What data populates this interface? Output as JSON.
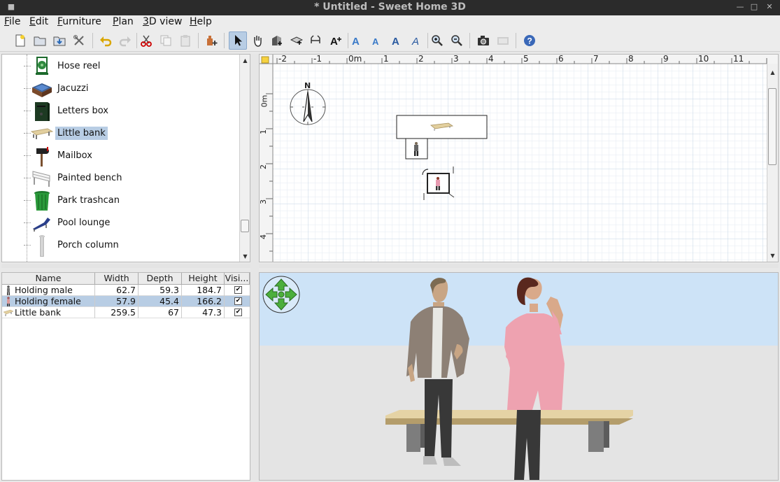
{
  "window": {
    "title": "* Untitled - Sweet Home 3D"
  },
  "menu": [
    {
      "label": "File",
      "u": "F",
      "rest": "ile"
    },
    {
      "label": "Edit",
      "u": "E",
      "rest": "dit"
    },
    {
      "label": "Furniture",
      "u": "F",
      "rest": "urniture"
    },
    {
      "label": "Plan",
      "u": "P",
      "rest": "lan"
    },
    {
      "label": "3D view",
      "u": "3",
      "rest": "D view"
    },
    {
      "label": "Help",
      "u": "H",
      "rest": "elp"
    }
  ],
  "catalog": {
    "items": [
      {
        "label": "Hose reel",
        "icon": "hose-reel-icon"
      },
      {
        "label": "Jacuzzi",
        "icon": "jacuzzi-icon"
      },
      {
        "label": "Letters box",
        "icon": "letters-box-icon"
      },
      {
        "label": "Little bank",
        "icon": "bench-icon",
        "selected": true
      },
      {
        "label": "Mailbox",
        "icon": "mailbox-icon"
      },
      {
        "label": "Painted bench",
        "icon": "painted-bench-icon"
      },
      {
        "label": "Park trashcan",
        "icon": "trashcan-icon"
      },
      {
        "label": "Pool lounge",
        "icon": "pool-lounge-icon"
      },
      {
        "label": "Porch column",
        "icon": "column-icon"
      }
    ]
  },
  "furniture_table": {
    "columns": [
      "Name",
      "Width",
      "Depth",
      "Height",
      "Visi..."
    ],
    "rows": [
      {
        "name": "Holding male",
        "width": "62.7",
        "depth": "59.3",
        "height": "184.7",
        "visible": "✔"
      },
      {
        "name": "Holding female",
        "width": "57.9",
        "depth": "45.4",
        "height": "166.2",
        "visible": "✔",
        "selected": true
      },
      {
        "name": "Little bank",
        "width": "259.5",
        "depth": "67",
        "height": "47.3",
        "visible": "✔"
      }
    ]
  },
  "plan": {
    "ruler_x": [
      "-2",
      "-1",
      "0m",
      "1",
      "2",
      "3",
      "4",
      "5",
      "6",
      "7",
      "8",
      "9",
      "10",
      "11"
    ],
    "ruler_y": [
      "0m",
      "1",
      "2",
      "3",
      "4"
    ],
    "compass_label": "N"
  },
  "colors": {
    "selection": "#b8cde4",
    "sky": "#cde3f7",
    "ground": "#e4e4e4",
    "grid": "#cfdcea"
  }
}
